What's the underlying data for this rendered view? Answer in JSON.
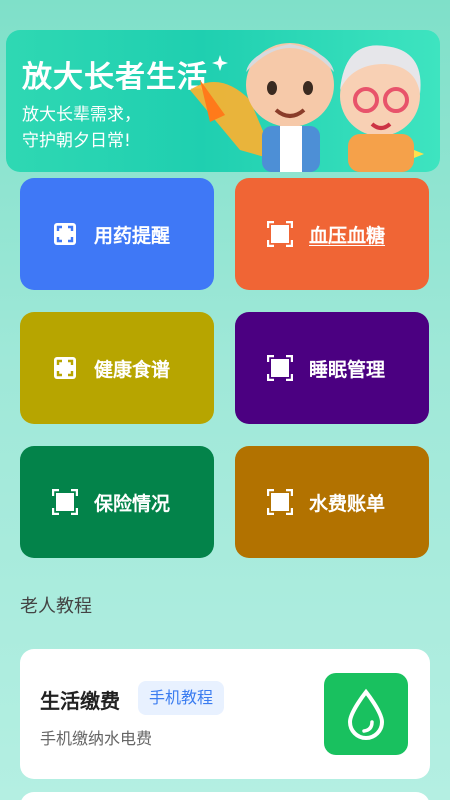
{
  "banner": {
    "title": "放大长者生活",
    "subtitle_line1": "放大长辈需求，",
    "subtitle_line2": "守护朝夕日常!"
  },
  "tiles": [
    {
      "label": "用药提醒",
      "color": "#3f78f6",
      "icon": "scan-frame-icon"
    },
    {
      "label": "血压血糖",
      "color": "#f06535",
      "icon": "square-frame-icon"
    },
    {
      "label": "健康食谱",
      "color": "#b7a500",
      "icon": "scan-frame-icon"
    },
    {
      "label": "睡眠管理",
      "color": "#4b0081",
      "icon": "square-frame-icon"
    },
    {
      "label": "保险情况",
      "color": "#03834a",
      "icon": "square-frame-icon"
    },
    {
      "label": "水费账单",
      "color": "#b27200",
      "icon": "square-frame-icon"
    }
  ],
  "section": {
    "title": "老人教程"
  },
  "tutorial_card": {
    "title": "生活缴费",
    "tag": "手机教程",
    "description": "手机缴纳水电费",
    "icon": "water-drop-icon",
    "icon_color": "#19c15f"
  }
}
